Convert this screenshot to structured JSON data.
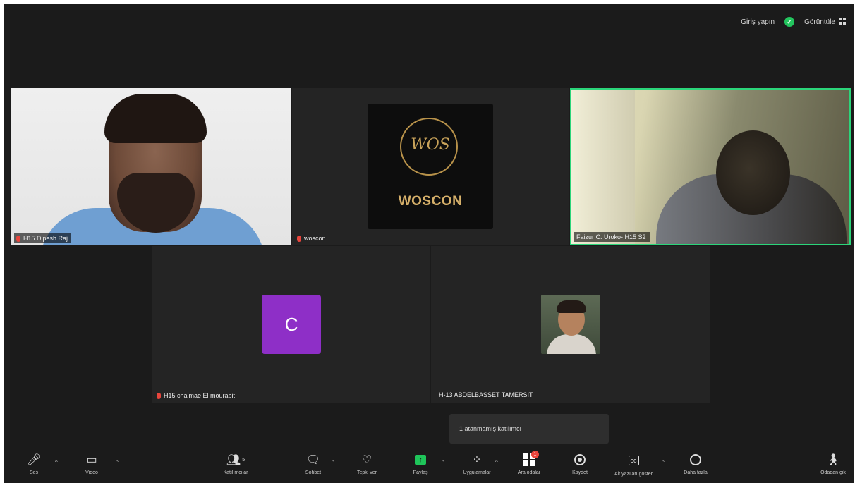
{
  "topbar": {
    "login_label": "Giriş yapın",
    "view_label": "Görüntüle"
  },
  "tiles": {
    "tile1_name": "H15 Dipesh Raj",
    "tile2_name": "woscon",
    "tile2_logo_monogram": "WOS",
    "tile2_logo_text": "WOSCON",
    "tile3_name": "Faizur C. Uroko- H15 S2",
    "tile4_avatar_letter": "C",
    "tile4_name": "H15 chaimae El mourabit",
    "tile5_name": "H-13 ABDELBASSET TAMERSIT"
  },
  "tooltip": {
    "text": "1 atanmamış katılımcı"
  },
  "toolbar": {
    "audio_label": "Ses",
    "video_label": "Video",
    "participants_label": "Katılımcılar",
    "participants_count": "5",
    "chat_label": "Sohbet",
    "react_label": "Tepki ver",
    "share_label": "Paylaş",
    "apps_label": "Uygulamalar",
    "breakout_label": "Ara odalar",
    "breakout_badge": "1",
    "record_label": "Kaydet",
    "captions_label": "Alt yazıları göster",
    "more_label": "Daha fazla",
    "leave_label": "Odadan çık"
  },
  "colors": {
    "accent_green": "#2bd57a",
    "avatar_purple": "#8e2fc7",
    "mute_red": "#e8453c"
  }
}
